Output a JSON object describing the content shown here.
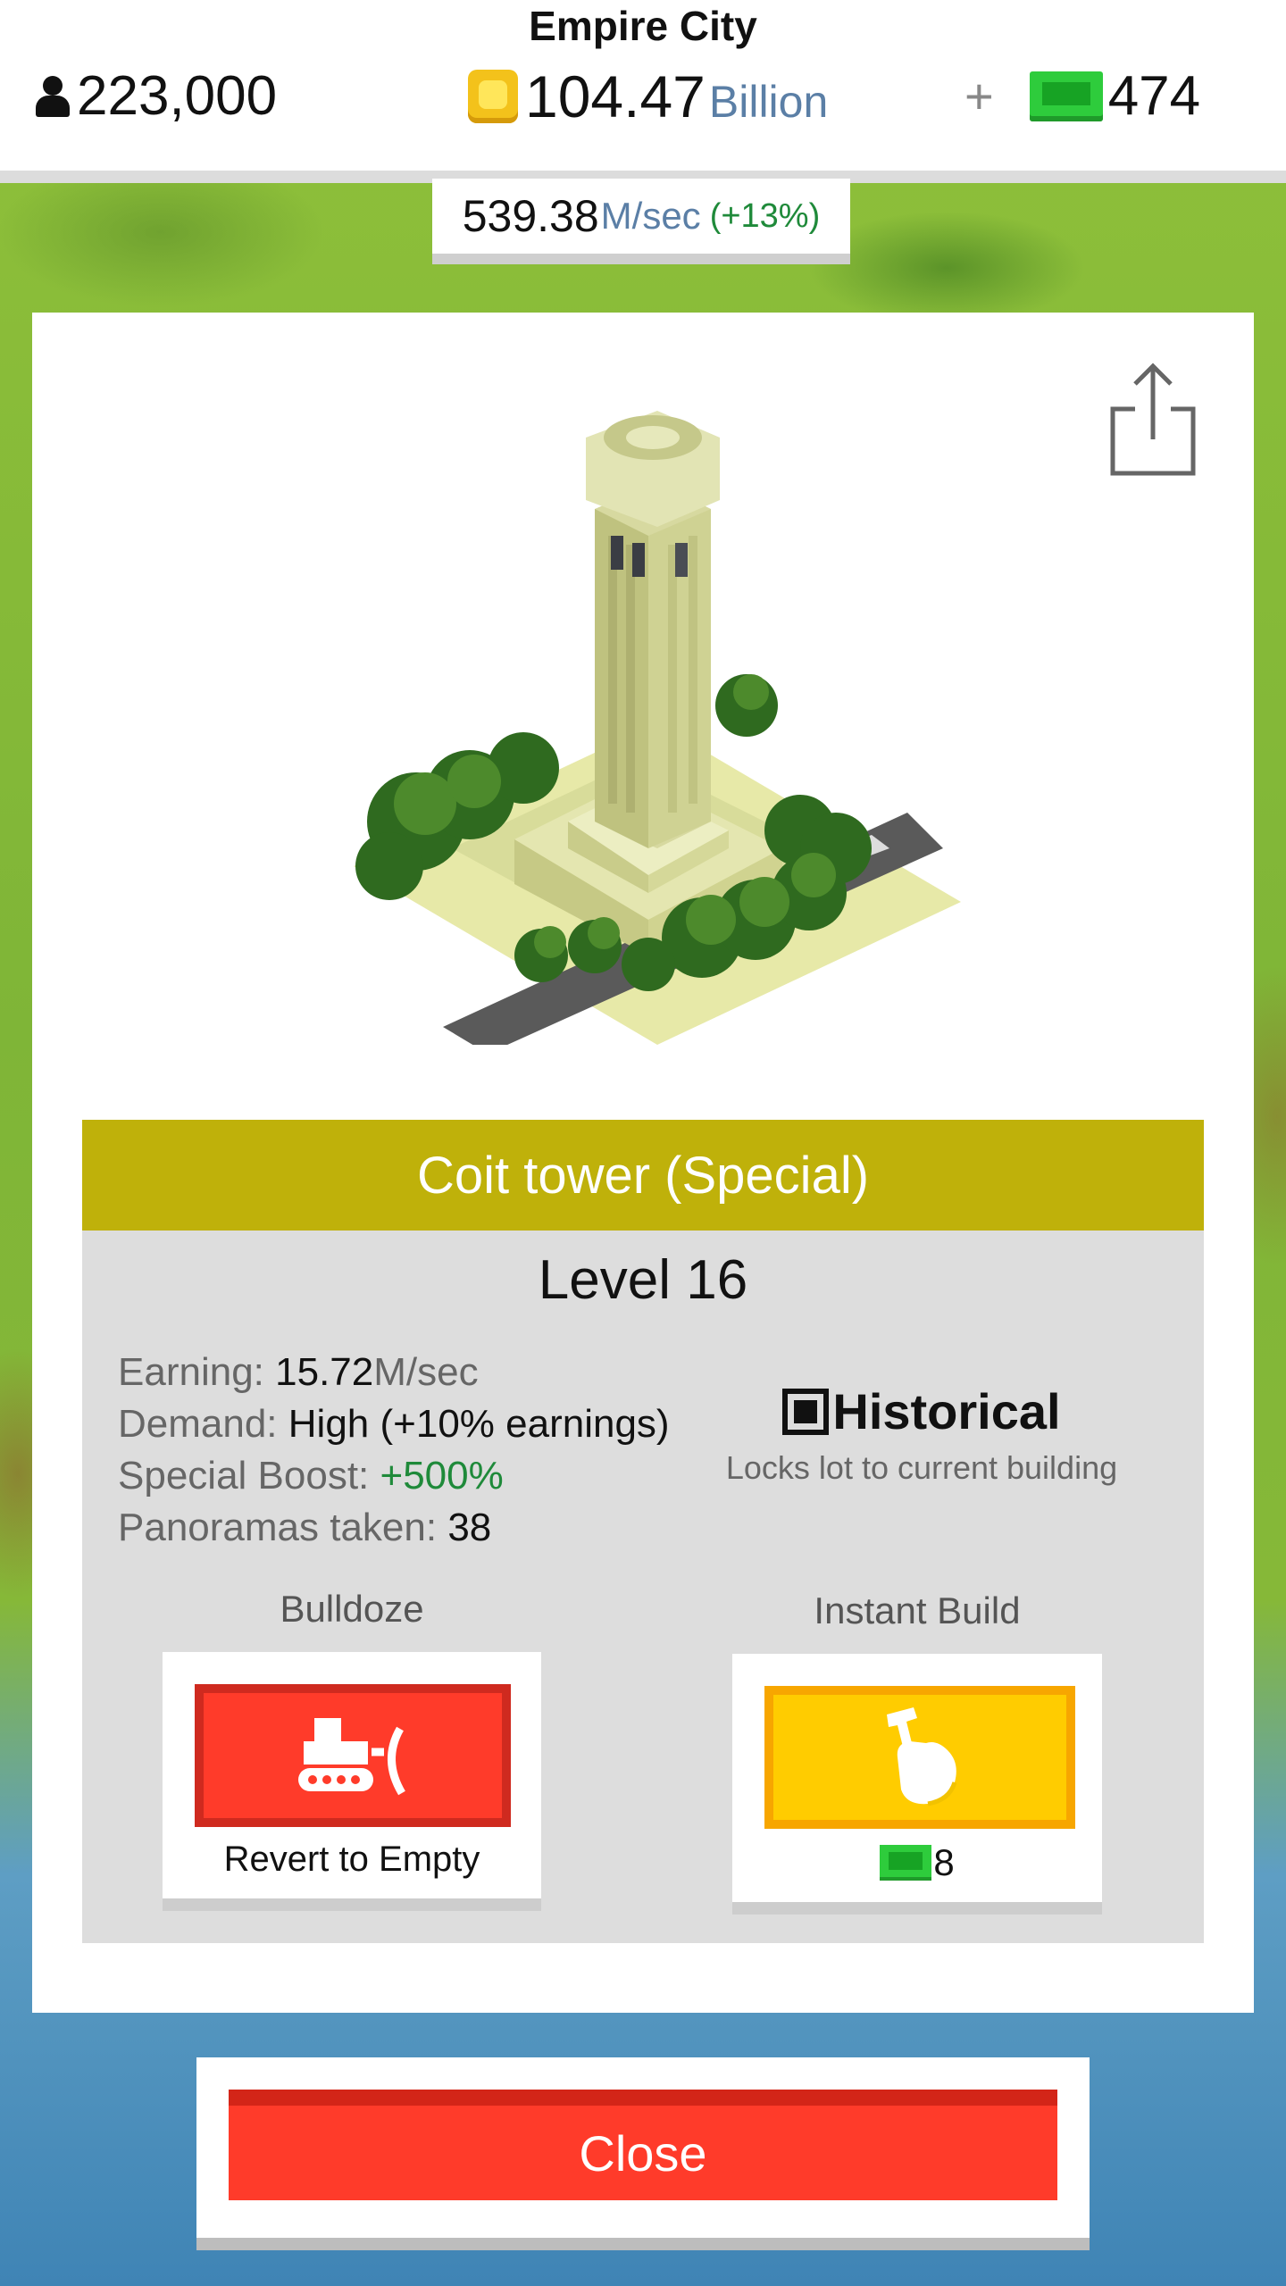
{
  "header": {
    "city_name": "Empire City",
    "population": "223,000",
    "cash_value": "104.47",
    "cash_unit": "Billion",
    "plus": "+",
    "bux": "474"
  },
  "income": {
    "value": "539.38",
    "unit": "M/sec",
    "boost": "(+13%)"
  },
  "building": {
    "name": "Coit tower (Special)",
    "level": "Level 16",
    "stats": {
      "earning_label": "Earning:",
      "earning_value": "15.72",
      "earning_unit": "M/sec",
      "demand_label": "Demand:",
      "demand_value": "High (+10% earnings)",
      "boost_label": "Special Boost:",
      "boost_value": "+500%",
      "panoramas_label": "Panoramas taken:",
      "panoramas_value": "38"
    },
    "historical": {
      "title": "Historical",
      "subtitle": "Locks lot to current building",
      "checked": true
    }
  },
  "actions": {
    "bulldoze_label": "Bulldoze",
    "bulldoze_caption": "Revert to Empty",
    "instant_label": "Instant Build",
    "instant_cost": "8"
  },
  "close_label": "Close",
  "icons": {
    "population": "person-icon",
    "cash": "coin-icon",
    "bux": "bux-icon",
    "share": "share-icon",
    "bulldozer": "bulldozer-icon",
    "instant_build": "hammer-hand-icon",
    "historical": "checkbox-icon"
  },
  "colors": {
    "name_bar": "#bfb10a",
    "bulldoze": "#ff3b2a",
    "instant_build": "#ffcc00",
    "close": "#ff3b2a",
    "bux": "#2ecc3c",
    "income_boost": "#1f8a3a"
  }
}
